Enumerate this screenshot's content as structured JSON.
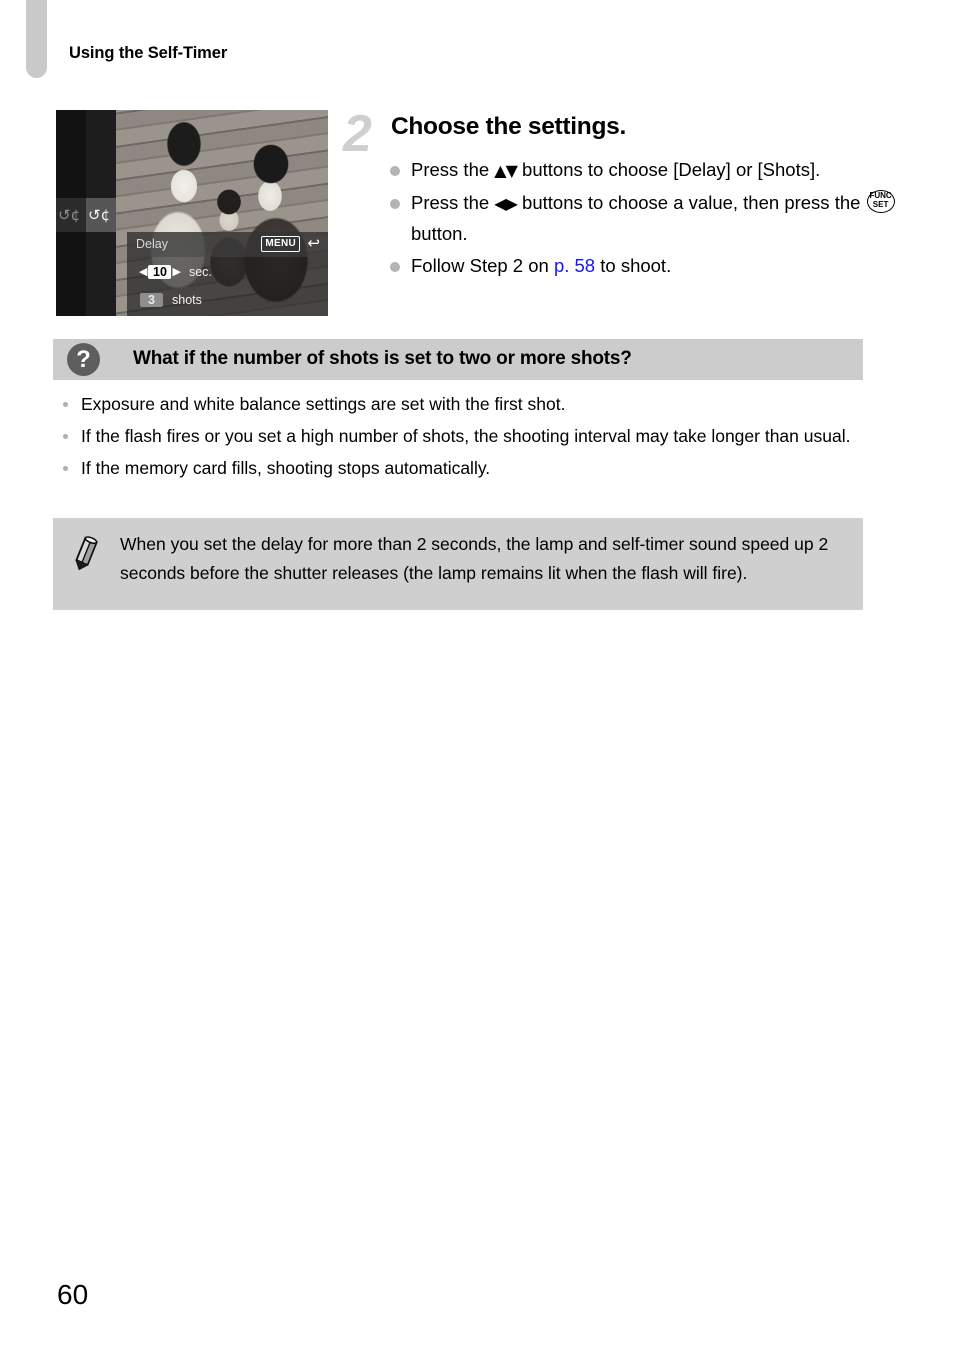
{
  "header": {
    "section_title": "Using the Self-Timer"
  },
  "figure": {
    "alt_name": "camera-self-timer-settings-screen",
    "timer_icon_dim": "↺¢",
    "timer_icon_lit": "↺¢",
    "panel_label": "Delay",
    "menu_badge": "MENU",
    "menu_arrow": "↩",
    "left_arrow": "◀",
    "right_arrow": "▶",
    "delay_value": "10",
    "delay_unit": "sec.",
    "shots_value": "3",
    "shots_unit": "shots"
  },
  "step": {
    "number": "2",
    "title": "Choose the settings.",
    "bullets": [
      {
        "before_glyph": "Press the ",
        "glyph": "▲▼",
        "after_glyph": " buttons to choose [Delay] or [Shots]."
      },
      {
        "before_glyph": "Press the ",
        "glyph": "◀▶",
        "after_glyph": " buttons to choose a value, then press the ",
        "func_top": "FUNC",
        "func_bottom": "SET",
        "tail": " button."
      },
      {
        "before_link": "Follow Step 2 on ",
        "link": "p. 58",
        "after_link": " to shoot."
      }
    ]
  },
  "qa": {
    "icon": "question-mark-icon",
    "icon_glyph": "?",
    "title": "What if the number of shots is set to two or more shots?",
    "items": [
      "Exposure and white balance settings are set with the first shot.",
      "If the flash fires or you set a high number of shots, the shooting interval may take longer than usual.",
      "If the memory card fills, shooting stops automatically."
    ]
  },
  "note": {
    "icon": "pencil-icon",
    "text": "When you set the delay for more than 2 seconds, the lamp and self-timer sound speed up 2 seconds before the shutter releases (the lamp remains lit when the flash will fire)."
  },
  "footer": {
    "page_number": "60"
  },
  "colors": {
    "accent_link": "#1414ff",
    "band_gray": "#cccccc",
    "note_gray": "#cfcfcf",
    "tab_gray": "#c9c9c9",
    "step_number_gray": "#cfcfcf"
  }
}
